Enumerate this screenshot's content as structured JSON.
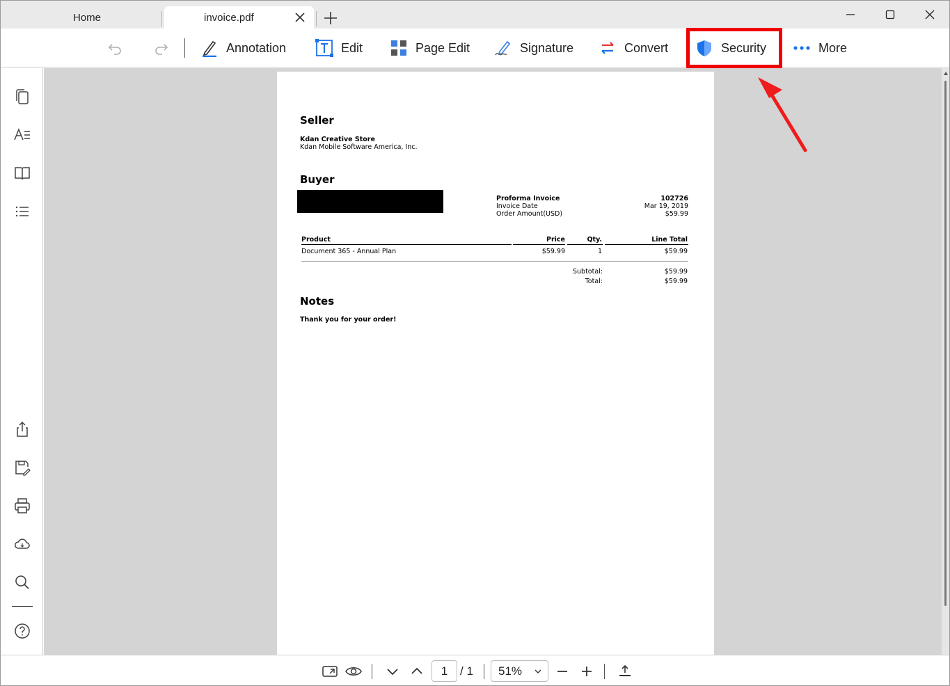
{
  "tabs": [
    {
      "label": "Home"
    },
    {
      "label": "invoice.pdf"
    }
  ],
  "toolbar": {
    "annotation": "Annotation",
    "edit": "Edit",
    "page_edit": "Page Edit",
    "signature": "Signature",
    "convert": "Convert",
    "security": "Security",
    "more": "More"
  },
  "accent_color": "#1a73e8",
  "highlight_color": "#f00000",
  "document": {
    "seller_heading": "Seller",
    "seller_name": "Kdan Creative Store",
    "seller_company": "Kdan Mobile Software America, Inc.",
    "buyer_heading": "Buyer",
    "proforma_label": "Proforma Invoice",
    "proforma_value": "102726",
    "invoice_date_label": "Invoice Date",
    "invoice_date_value": "Mar 19, 2019",
    "order_amount_label": "Order Amount(USD)",
    "order_amount_value": "$59.99",
    "table_headers": [
      "Product",
      "Price",
      "Qty.",
      "Line Total"
    ],
    "rows": [
      {
        "product": "Document 365 - Annual Plan",
        "price": "$59.99",
        "qty": "1",
        "line_total": "$59.99"
      }
    ],
    "subtotal_label": "Subtotal:",
    "subtotal_value": "$59.99",
    "total_label": "Total:",
    "total_value": "$59.99",
    "notes_heading": "Notes",
    "notes_text": "Thank you for your order!"
  },
  "bottombar": {
    "page_current": "1",
    "page_total": "/ 1",
    "zoom": "51%"
  }
}
